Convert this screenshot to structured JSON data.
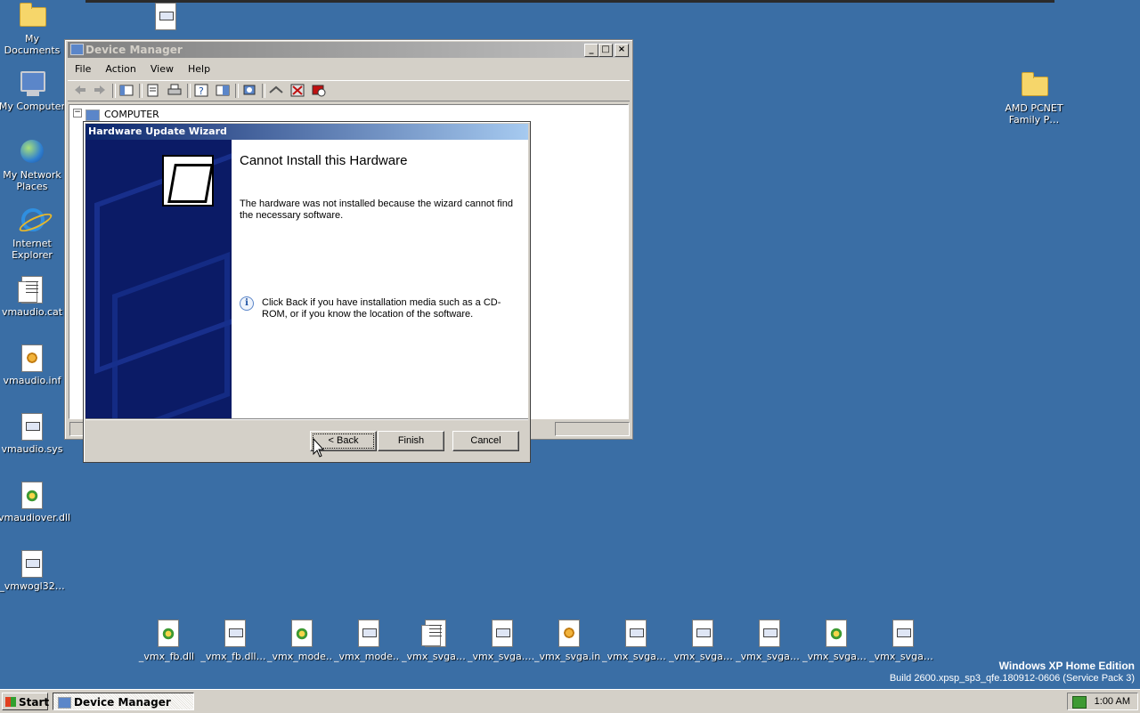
{
  "desktop": {
    "left_icons": [
      {
        "label": "My Documents",
        "icon": "folder-documents-icon"
      },
      {
        "label": "My Computer",
        "icon": "computer-icon"
      },
      {
        "label": "My Network Places",
        "icon": "network-icon"
      },
      {
        "label": "Internet Explorer",
        "icon": "internet-explorer-icon"
      },
      {
        "label": "vmaudio.cat",
        "icon": "catalog-file-icon"
      },
      {
        "label": "vmaudio.inf",
        "icon": "setup-info-file-icon"
      },
      {
        "label": "vmaudio.sys",
        "icon": "system-file-icon"
      },
      {
        "label": "vmaudiover.dll",
        "icon": "dll-file-icon"
      },
      {
        "label": "_vmwogl32…",
        "icon": "system-file-icon"
      }
    ],
    "right_icons": [
      {
        "label": "AMD PCNET Family P…",
        "icon": "folder-icon"
      }
    ],
    "bottom_icons": [
      {
        "label": "_vmx_fb.dll",
        "icon": "dll-file-icon"
      },
      {
        "label": "_vmx_fb.dll…",
        "icon": "system-file-icon"
      },
      {
        "label": "_vmx_mode…",
        "icon": "dll-file-icon"
      },
      {
        "label": "_vmx_mode…",
        "icon": "system-file-icon"
      },
      {
        "label": "_vmx_svga…",
        "icon": "catalog-file-icon"
      },
      {
        "label": "_vmx_svga.…",
        "icon": "system-file-icon"
      },
      {
        "label": "_vmx_svga.inf",
        "icon": "setup-info-file-icon"
      },
      {
        "label": "_vmx_svga…",
        "icon": "system-file-icon"
      },
      {
        "label": "_vmx_svga…",
        "icon": "system-file-icon"
      },
      {
        "label": "_vmx_svga…",
        "icon": "system-file-icon"
      },
      {
        "label": "_vmx_svga…",
        "icon": "dll-file-icon"
      },
      {
        "label": "_vmx_svga…",
        "icon": "system-file-icon"
      }
    ]
  },
  "device_manager": {
    "title": "Device Manager",
    "menu": [
      "File",
      "Action",
      "View",
      "Help"
    ],
    "tree_root": "COMPUTER",
    "window_buttons": {
      "minimize": "_",
      "maximize": "□",
      "close": "×"
    }
  },
  "wizard": {
    "title": "Hardware Update Wizard",
    "heading": "Cannot Install this Hardware",
    "message": "The hardware was not installed because the wizard cannot find the necessary software.",
    "info_icon": "i",
    "hint": "Click Back if you have installation media such as a CD-ROM, or if you know the location of the software.",
    "buttons": {
      "back": "< Back",
      "finish": "Finish",
      "cancel": "Cancel"
    }
  },
  "watermark": {
    "edition": "Windows XP Home Edition",
    "build": "Build 2600.xpsp_sp3_qfe.180912-0606 (Service Pack 3)"
  },
  "taskbar": {
    "start_label": "Start",
    "task_label": "Device Manager",
    "clock": "1:00 AM"
  }
}
